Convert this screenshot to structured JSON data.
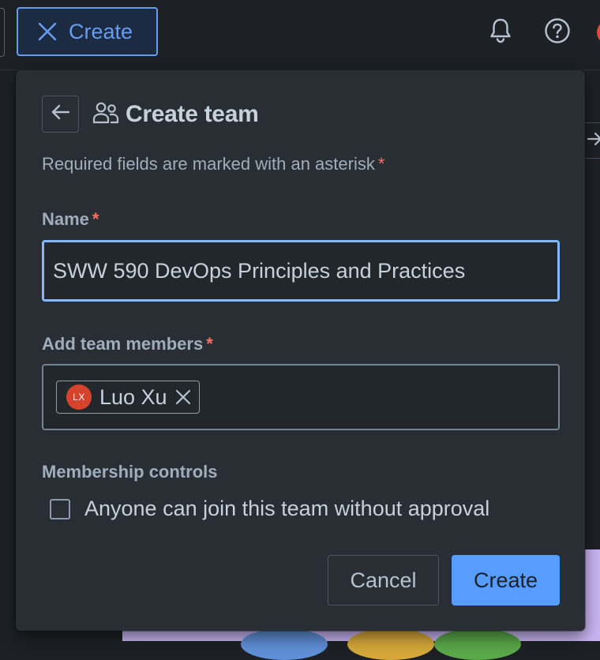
{
  "topbar": {
    "create_label": "Create",
    "icons": [
      "close-icon",
      "bell-icon",
      "help-icon"
    ]
  },
  "dialog": {
    "title": "Create team",
    "required_note": "Required fields are marked with an asterisk",
    "asterisk": "*",
    "name_label": "Name",
    "name_value": "SWW 590 DevOps Principles and Practices",
    "members_label": "Add team members",
    "members": [
      {
        "initials": "LX",
        "name": "Luo Xu"
      }
    ],
    "membership_label": "Membership controls",
    "checkbox_label": "Anyone can join this team without approval",
    "checkbox_checked": false,
    "cancel_label": "Cancel",
    "create_label": "Create"
  },
  "colors": {
    "accent": "#579dff",
    "required": "#f87168",
    "avatar": "#d6432c",
    "panel": "#282e33",
    "background": "#1d2125"
  }
}
